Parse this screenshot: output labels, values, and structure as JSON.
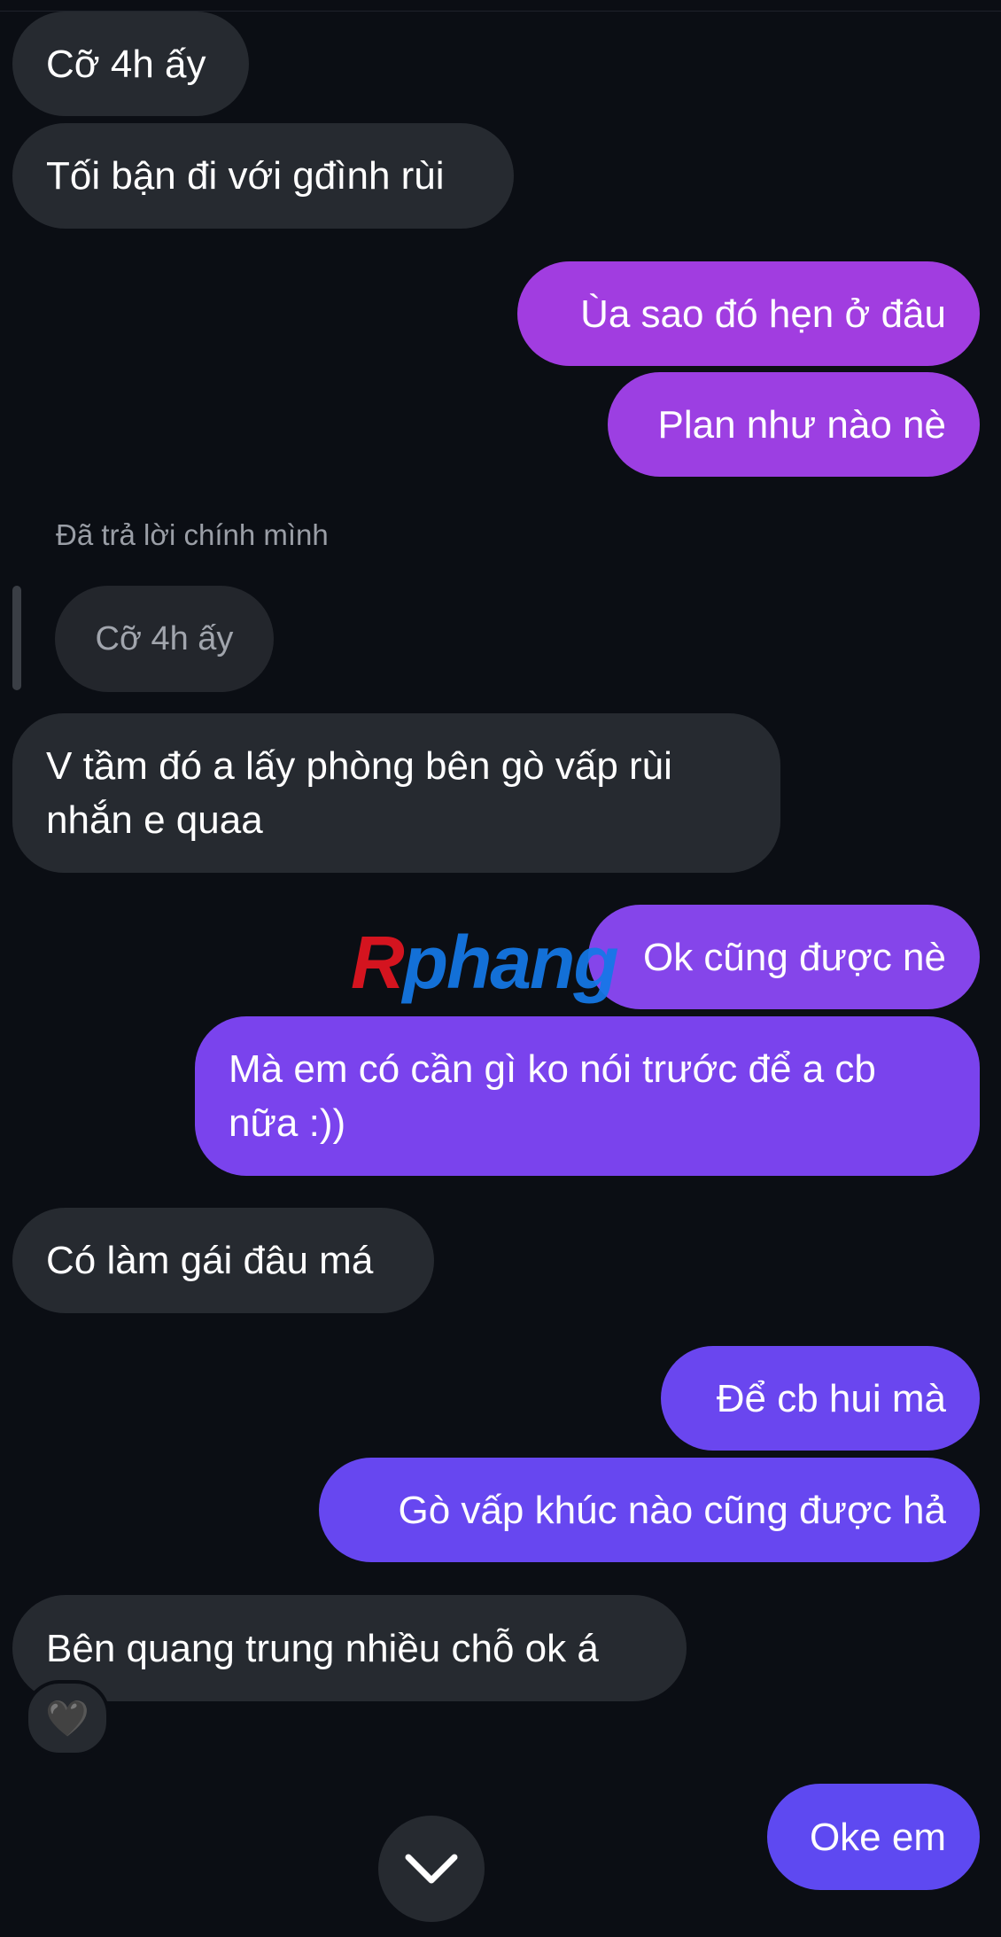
{
  "messages": [
    {
      "id": "m1",
      "text": "Cỡ 4h ấy"
    },
    {
      "id": "m2",
      "text": "Tối bận đi với gđình rùi"
    },
    {
      "id": "m3",
      "text": "Ùa sao đó hẹn ở đâu"
    },
    {
      "id": "m4",
      "text": "Plan như nào nè"
    },
    {
      "id": "m5",
      "text": "V tầm đó a lấy phòng bên gò vấp rùi nhắn e quaa"
    },
    {
      "id": "m6",
      "text": "Ok cũng được nè"
    },
    {
      "id": "m7",
      "text": "Mà em có cần gì ko nói trước để a cb nữa :))"
    },
    {
      "id": "m8",
      "text": "Có làm gái đâu má"
    },
    {
      "id": "m9",
      "text": "Để cb hui mà"
    },
    {
      "id": "m10",
      "text": "Gò vấp khúc nào cũng được hả"
    },
    {
      "id": "m11",
      "text": "Bên quang trung nhiều chỗ ok á"
    },
    {
      "id": "m12",
      "text": "Oke em"
    }
  ],
  "reply": {
    "label": "Đã trả lời chính mình",
    "quoted_text": "Cỡ 4h ấy"
  },
  "reaction": {
    "emoji": "🖤",
    "icon": "black-heart-icon"
  },
  "watermark": {
    "first_letter": "R",
    "rest": "phang"
  },
  "scroll_button": {
    "icon": "chevron-down-icon"
  },
  "colors": {
    "background": "#0b0e14",
    "received_bubble": "#262a30",
    "sent_gradient_top": "#a23ce0",
    "sent_gradient_bottom": "#5a4cf0"
  }
}
